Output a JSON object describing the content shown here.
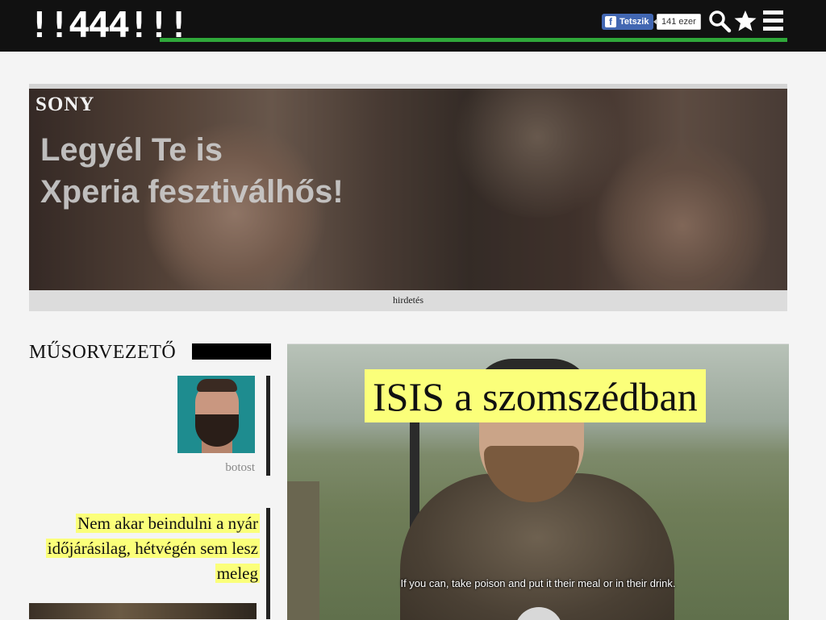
{
  "header": {
    "logo_text": "!!444!!!",
    "like_label": "Tetszik",
    "like_count": "141 ezer",
    "accent_color": "#2fa83a",
    "icons": [
      "search-icon",
      "star-icon",
      "hamburger-menu-icon"
    ]
  },
  "ad": {
    "brand": "SONY",
    "headline_1": "Legyél Te is",
    "headline_2": "Xperia fesztiválhős!",
    "label": "hirdetés"
  },
  "sidebar": {
    "section_title": "MŰSORVEZETŐ",
    "host_name": "botost",
    "headline": "Nem akar beindulni a nyár időjárásilag, hétvégén sem lesz meleg"
  },
  "main_article": {
    "title": "ISIS a szomszédban",
    "video_subtitle": "If you can, take poison and put it their meal or in their drink."
  },
  "colors": {
    "highlight": "#fbff7a",
    "header_bg": "#111111",
    "page_bg": "#f4f4f4"
  }
}
